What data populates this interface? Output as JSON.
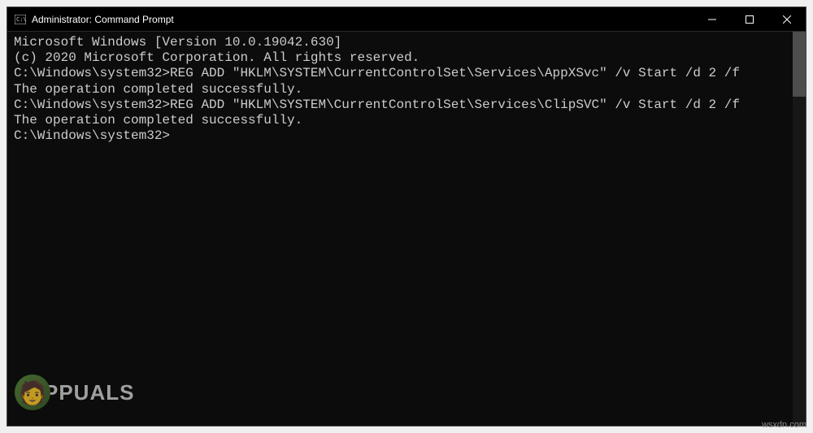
{
  "window": {
    "title": "Administrator: Command Prompt"
  },
  "terminal": {
    "lines": [
      "Microsoft Windows [Version 10.0.19042.630]",
      "(c) 2020 Microsoft Corporation. All rights reserved.",
      "",
      "C:\\Windows\\system32>REG ADD \"HKLM\\SYSTEM\\CurrentControlSet\\Services\\AppXSvc\" /v Start /d 2 /f",
      "The operation completed successfully.",
      "",
      "C:\\Windows\\system32>REG ADD \"HKLM\\SYSTEM\\CurrentControlSet\\Services\\ClipSVC\" /v Start /d 2 /f",
      "The operation completed successfully.",
      "",
      "C:\\Windows\\system32>"
    ]
  },
  "watermark": {
    "text": "PPUALS"
  },
  "source": "wsxdn.com"
}
